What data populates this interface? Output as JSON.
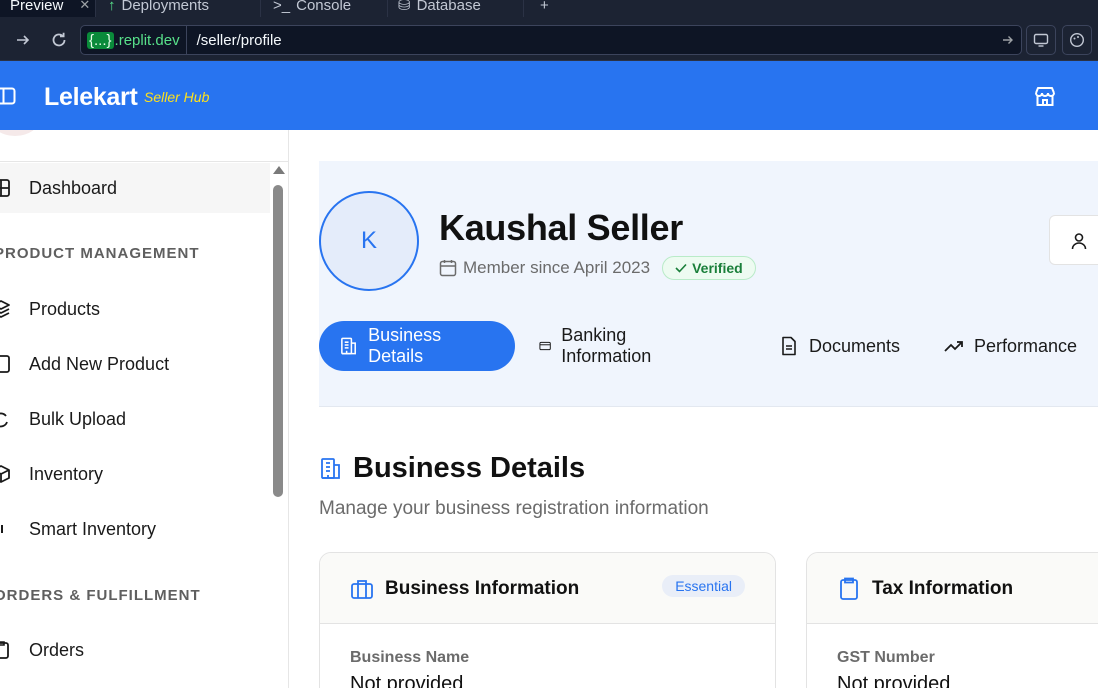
{
  "browser": {
    "tabs": [
      {
        "label": "Preview",
        "active": true
      },
      {
        "label": "Deployments",
        "icon": "deploy-icon"
      },
      {
        "label": "Console",
        "icon": "terminal-icon"
      },
      {
        "label": "Database",
        "icon": "database-icon"
      }
    ],
    "url_domain_brace": "{...}",
    "url_domain": ".replit.dev",
    "url_path": "/seller/profile"
  },
  "header": {
    "brand": "Lelekart",
    "brand_sub": "Seller Hub",
    "colors": {
      "brand": "#2874f0",
      "accent": "#ffe11b"
    }
  },
  "sidebar": {
    "items": [
      {
        "label": "Dashboard",
        "icon": "grid-icon",
        "active": true
      },
      {
        "section": "PRODUCT MANAGEMENT"
      },
      {
        "label": "Products",
        "icon": "layers-icon"
      },
      {
        "label": "Add New Product",
        "icon": "add-icon"
      },
      {
        "label": "Bulk Upload",
        "icon": "upload-icon"
      },
      {
        "label": "Inventory",
        "icon": "box-icon"
      },
      {
        "label": "Smart Inventory",
        "icon": "chart-icon"
      },
      {
        "section": "ORDERS & FULFILLMENT"
      },
      {
        "label": "Orders",
        "icon": "clipboard-icon"
      }
    ]
  },
  "profile": {
    "initial": "K",
    "name": "Kaushal Seller",
    "member_since": "Member since April 2023",
    "verified": "Verified",
    "tabs": [
      "Business Details",
      "Banking Information",
      "Documents",
      "Performance"
    ]
  },
  "section": {
    "title": "Business Details",
    "subtitle": "Manage your business registration information"
  },
  "cards": [
    {
      "title": "Business Information",
      "badge": "Essential",
      "field_label": "Business Name",
      "field_value": "Not provided"
    },
    {
      "title": "Tax Information",
      "field_label": "GST Number",
      "field_value": "Not provided"
    }
  ]
}
